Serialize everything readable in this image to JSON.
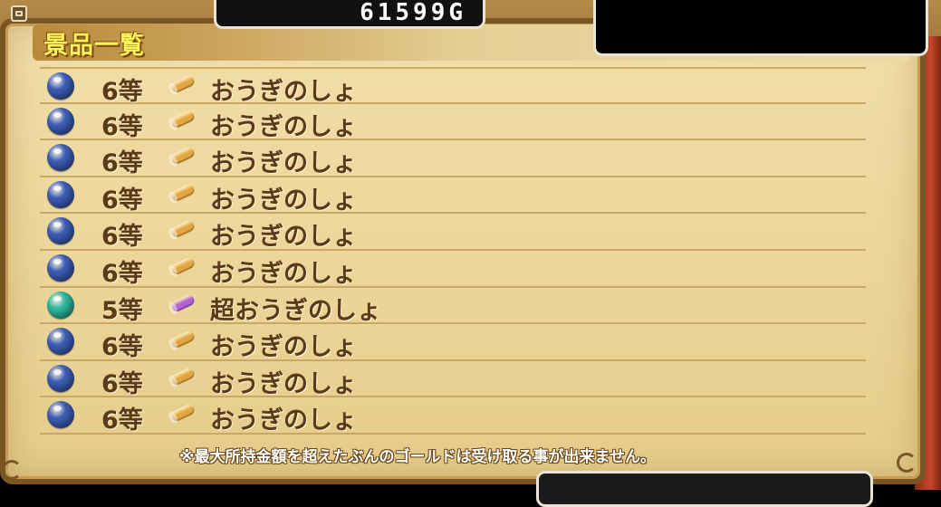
{
  "gold": "61599G",
  "header": {
    "title": "景品一覧"
  },
  "colors": {
    "orb_blue": "#3c5cb4",
    "orb_teal": "#2cb49c",
    "scroll_gold": "#e0a640",
    "scroll_purple": "#b060d0"
  },
  "prizes": [
    {
      "rank": "6等",
      "orb": "blue-orb-icon",
      "icon": "scroll-icon",
      "name": "おうぎのしょ"
    },
    {
      "rank": "6等",
      "orb": "blue-orb-icon",
      "icon": "scroll-icon",
      "name": "おうぎのしょ"
    },
    {
      "rank": "6等",
      "orb": "blue-orb-icon",
      "icon": "scroll-icon",
      "name": "おうぎのしょ"
    },
    {
      "rank": "6等",
      "orb": "blue-orb-icon",
      "icon": "scroll-icon",
      "name": "おうぎのしょ"
    },
    {
      "rank": "6等",
      "orb": "blue-orb-icon",
      "icon": "scroll-icon",
      "name": "おうぎのしょ"
    },
    {
      "rank": "6等",
      "orb": "blue-orb-icon",
      "icon": "scroll-icon",
      "name": "おうぎのしょ"
    },
    {
      "rank": "5等",
      "orb": "teal-orb-icon",
      "icon": "super-scroll-icon",
      "name": "超おうぎのしょ"
    },
    {
      "rank": "6等",
      "orb": "blue-orb-icon",
      "icon": "scroll-icon",
      "name": "おうぎのしょ"
    },
    {
      "rank": "6等",
      "orb": "blue-orb-icon",
      "icon": "scroll-icon",
      "name": "おうぎのしょ"
    },
    {
      "rank": "6等",
      "orb": "blue-orb-icon",
      "icon": "scroll-icon",
      "name": "おうぎのしょ"
    }
  ],
  "notice": "※最大所持金額を超えたぶんのゴールドは受け取る事が出来ません。"
}
